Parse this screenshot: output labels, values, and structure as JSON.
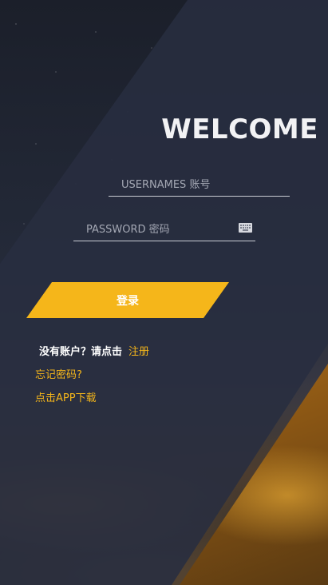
{
  "header": {
    "welcome": "WELCOME"
  },
  "form": {
    "username": {
      "placeholder": "USERNAMES 账号",
      "value": ""
    },
    "password": {
      "placeholder": "PASSWORD 密码",
      "value": "",
      "icon": "keyboard-icon"
    },
    "login_label": "登录"
  },
  "links": {
    "register_prompt": "没有账户？请点击",
    "register_label": "注册",
    "forgot_label": "忘记密码?",
    "download_label": "点击APP下载"
  },
  "colors": {
    "accent": "#f5b61a",
    "panel": "#282e40",
    "text": "#ffffff"
  }
}
